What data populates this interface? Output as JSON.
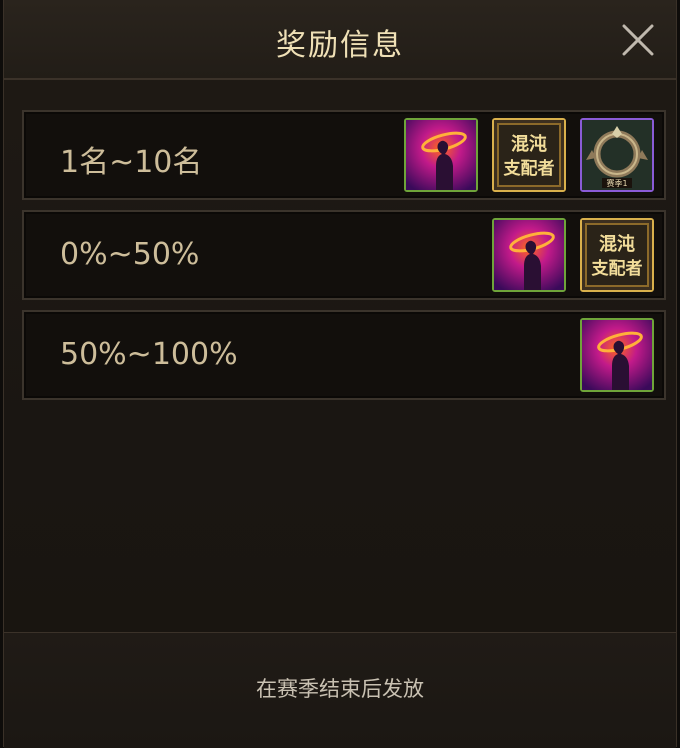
{
  "dialog": {
    "title": "奖励信息",
    "close_icon": "close-icon"
  },
  "rewards": [
    {
      "label": "1名~10名",
      "items": [
        "nebula-avatar-frame",
        "chaos-dominator-title",
        "rank-emblem"
      ]
    },
    {
      "label": "0%~50%",
      "items": [
        "nebula-avatar-frame",
        "chaos-dominator-title"
      ]
    },
    {
      "label": "50%~100%",
      "items": [
        "nebula-avatar-frame"
      ]
    }
  ],
  "item_text": {
    "title_badge_line1": "混沌",
    "title_badge_line2": "支配者",
    "emblem_tag": "赛季1"
  },
  "footer": {
    "note": "在赛季结束后发放"
  },
  "colors": {
    "title": "#efe0b6",
    "label": "#cdbd9a",
    "footer_text": "#c9c1b2",
    "gold_frame": "#d9b04c",
    "green_frame": "#6fa43a",
    "purple_frame": "#8a5bd6"
  }
}
